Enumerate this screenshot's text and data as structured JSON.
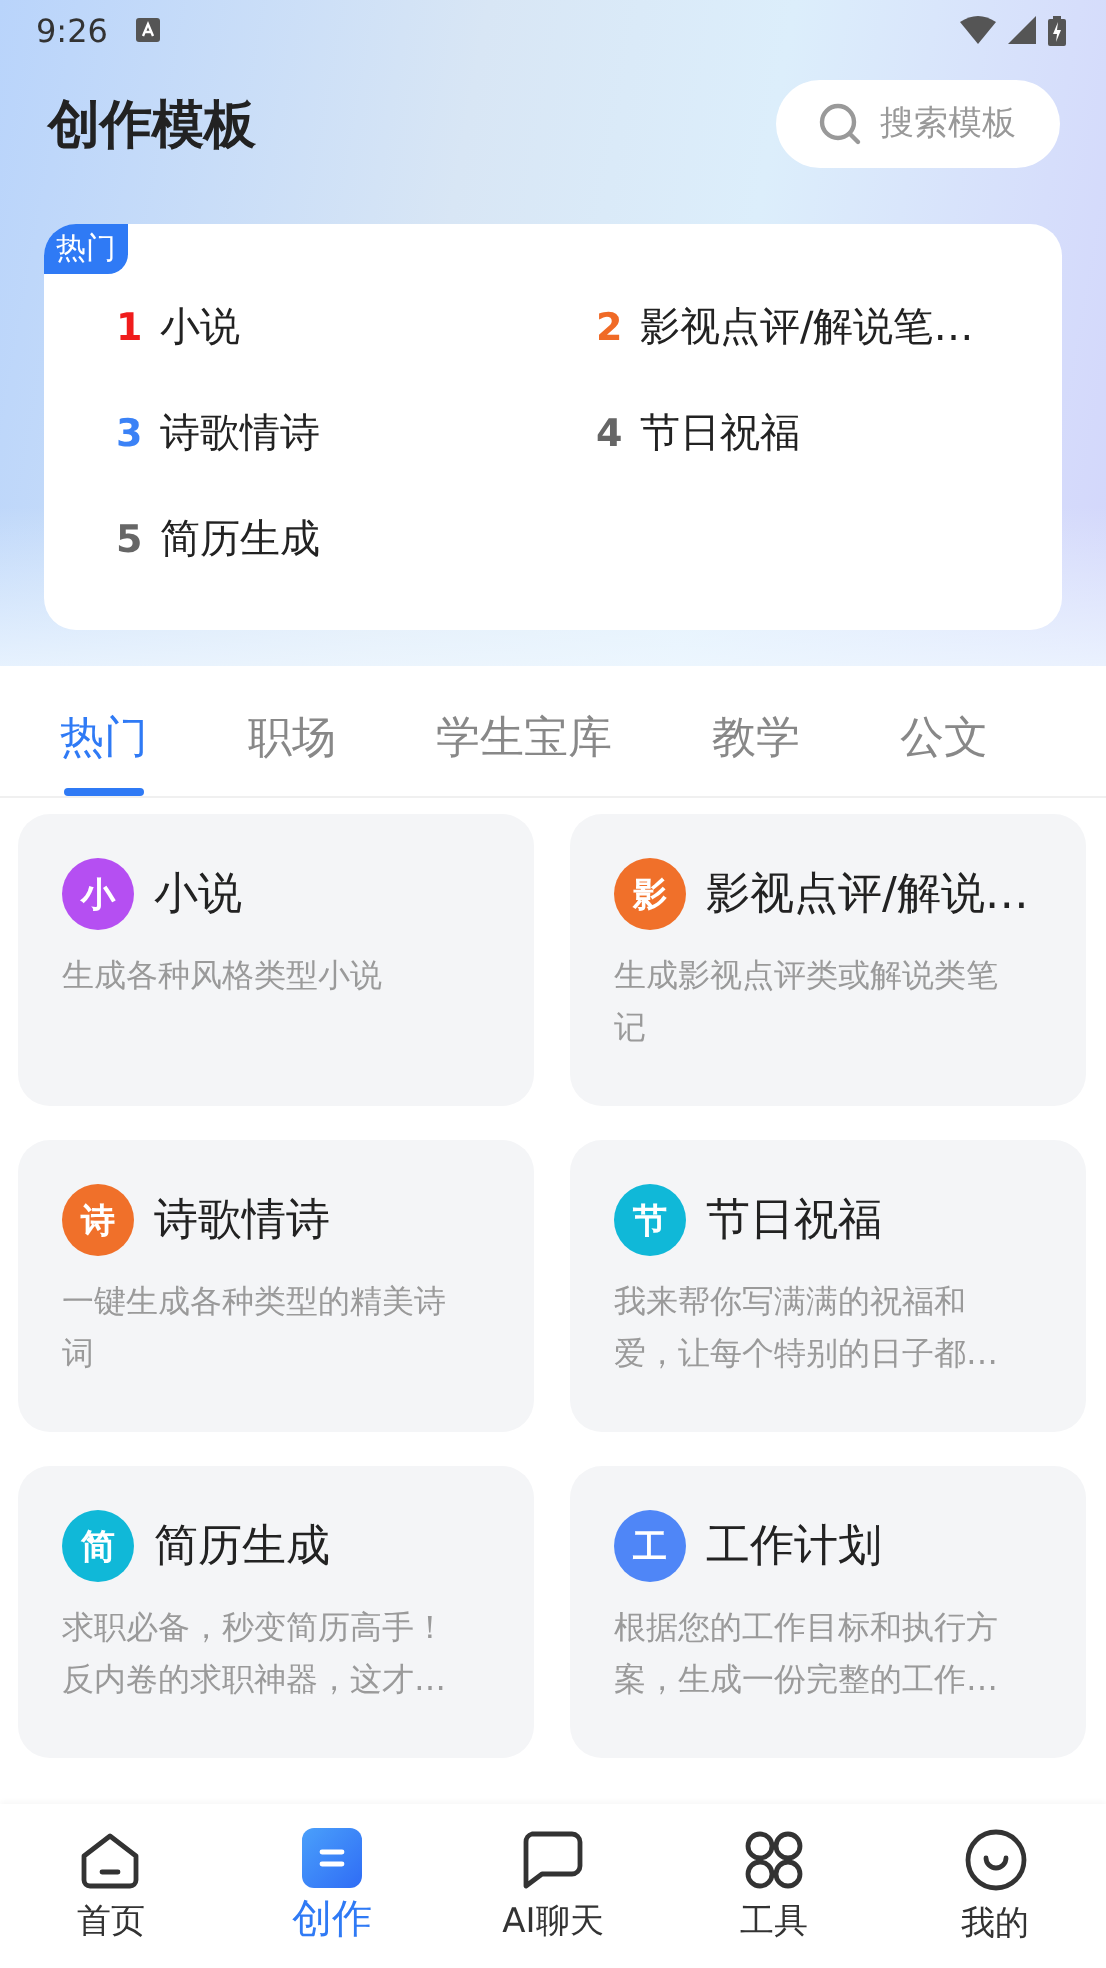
{
  "status_bar": {
    "time": "9:26"
  },
  "header": {
    "title": "创作模板",
    "search": {
      "placeholder": "搜索模板"
    }
  },
  "hot_list": {
    "badge": "热门",
    "items": [
      {
        "rank": "1",
        "title": "小说",
        "color": "#f01c1c"
      },
      {
        "rank": "2",
        "title": "影视点评/解说笔…",
        "color": "#f06a26"
      },
      {
        "rank": "3",
        "title": "诗歌情诗",
        "color": "#3b82f6"
      },
      {
        "rank": "4",
        "title": "节日祝福",
        "color": "#666666"
      },
      {
        "rank": "5",
        "title": "简历生成",
        "color": "#666666"
      }
    ]
  },
  "tabs": [
    {
      "label": "热门",
      "selected": true
    },
    {
      "label": "职场",
      "selected": false
    },
    {
      "label": "学生宝库",
      "selected": false
    },
    {
      "label": "教学",
      "selected": false
    },
    {
      "label": "公文",
      "selected": false
    }
  ],
  "templates": [
    {
      "icon_text": "小",
      "color": "#b54ff2",
      "title": "小说",
      "description": "生成各种风格类型小说"
    },
    {
      "icon_text": "影",
      "color": "#f0702a",
      "title": "影视点评/解说…",
      "description": "生成影视点评类或解说类笔记"
    },
    {
      "icon_text": "诗",
      "color": "#f0702a",
      "title": "诗歌情诗",
      "description": "一键生成各种类型的精美诗词"
    },
    {
      "icon_text": "节",
      "color": "#10b8d8",
      "title": "节日祝福",
      "description": "我来帮你写满满的祝福和爱，让每个特别的日子都…"
    },
    {
      "icon_text": "简",
      "color": "#10b8d8",
      "title": "简历生成",
      "description": "求职必备，秒变简历高手！反内卷的求职神器，这才…"
    },
    {
      "icon_text": "工",
      "color": "#4f86f7",
      "title": "工作计划",
      "description": "根据您的工作目标和执行方案，生成一份完整的工作…"
    }
  ],
  "bottom_nav": [
    {
      "kind": "home",
      "label": "首页",
      "selected": false
    },
    {
      "kind": "create",
      "label": "创作",
      "selected": true
    },
    {
      "kind": "chat",
      "label": "AI聊天",
      "selected": false
    },
    {
      "kind": "tools",
      "label": "工具",
      "selected": false
    },
    {
      "kind": "profile",
      "label": "我的",
      "selected": false
    }
  ]
}
